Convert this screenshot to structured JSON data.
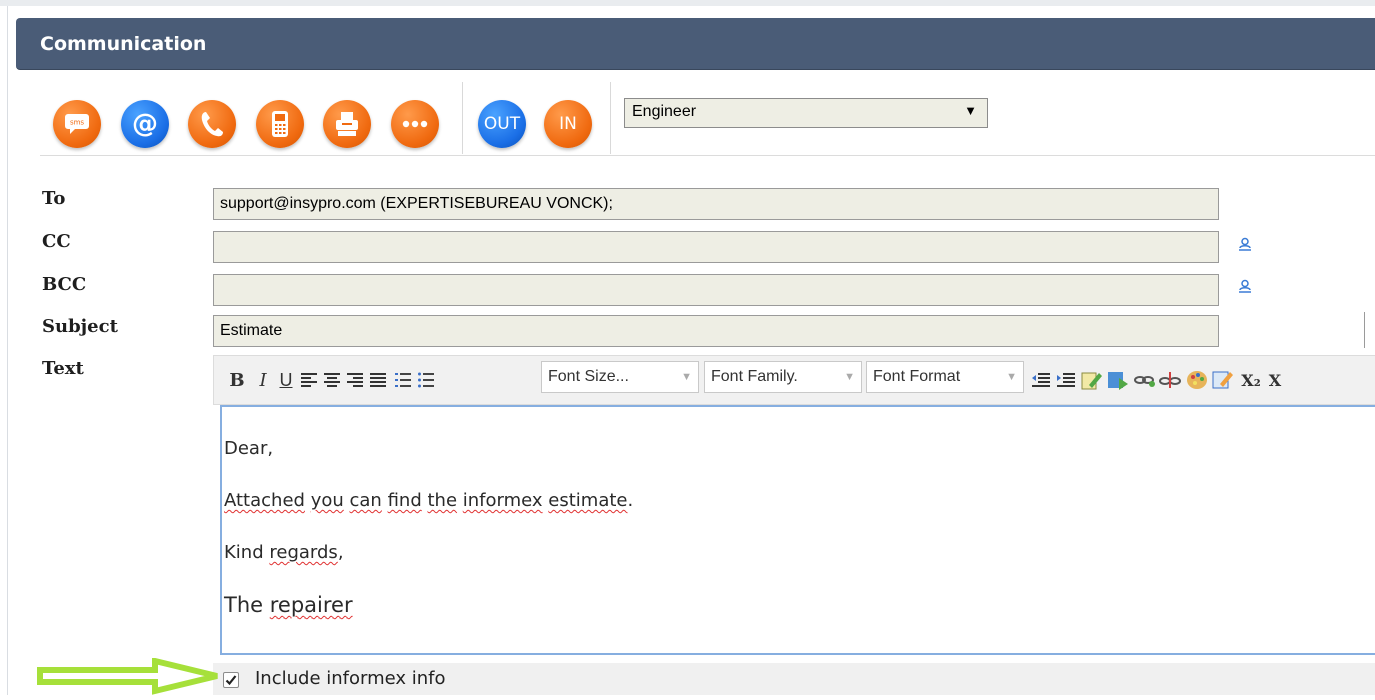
{
  "panel": {
    "title": "Communication"
  },
  "toolbar": {
    "buttons": [
      {
        "icon": "sms-icon",
        "label": "sms",
        "color": "#f06a10"
      },
      {
        "icon": "email-icon",
        "label": "@",
        "color": "#1a6ee6"
      },
      {
        "icon": "phone-icon",
        "color": "#f06a10"
      },
      {
        "icon": "mobile-icon",
        "color": "#f06a10"
      },
      {
        "icon": "fax-icon",
        "color": "#f06a10"
      },
      {
        "icon": "more-icon",
        "color": "#f06a10"
      }
    ],
    "direction": {
      "out_label": "OUT",
      "in_label": "IN"
    },
    "role_select": {
      "value": "Engineer"
    }
  },
  "fields": {
    "to": {
      "label": "To",
      "value": "support@insypro.com (EXPERTISEBUREAU VONCK);"
    },
    "cc": {
      "label": "CC",
      "value": ""
    },
    "bcc": {
      "label": "BCC",
      "value": ""
    },
    "subject": {
      "label": "Subject",
      "value": "Estimate"
    },
    "text": {
      "label": "Text"
    }
  },
  "editor_toolbar": {
    "bold": "B",
    "italic": "I",
    "underline": "U",
    "font_size": "Font Size...",
    "font_family": "Font Family.",
    "font_format": "Font Format",
    "subscript": "X₂",
    "superscript": "X"
  },
  "editor": {
    "greeting": "Dear,",
    "line2": {
      "w1": "Attached",
      "w2": "you",
      "w3": "can",
      "w4": "find",
      "w5": "the",
      "w6": "informex",
      "w7": "estimate",
      "end": "."
    },
    "line3": {
      "w1": "Kind",
      "w2": "regards",
      "end": ","
    },
    "line4": {
      "w1": "The",
      "w2": "repairer"
    }
  },
  "include": {
    "label": "Include informex info",
    "checked": true
  },
  "colors": {
    "header": "#4a5c77",
    "input_bg": "#eeeee4",
    "annotation": "#a6e03a"
  }
}
